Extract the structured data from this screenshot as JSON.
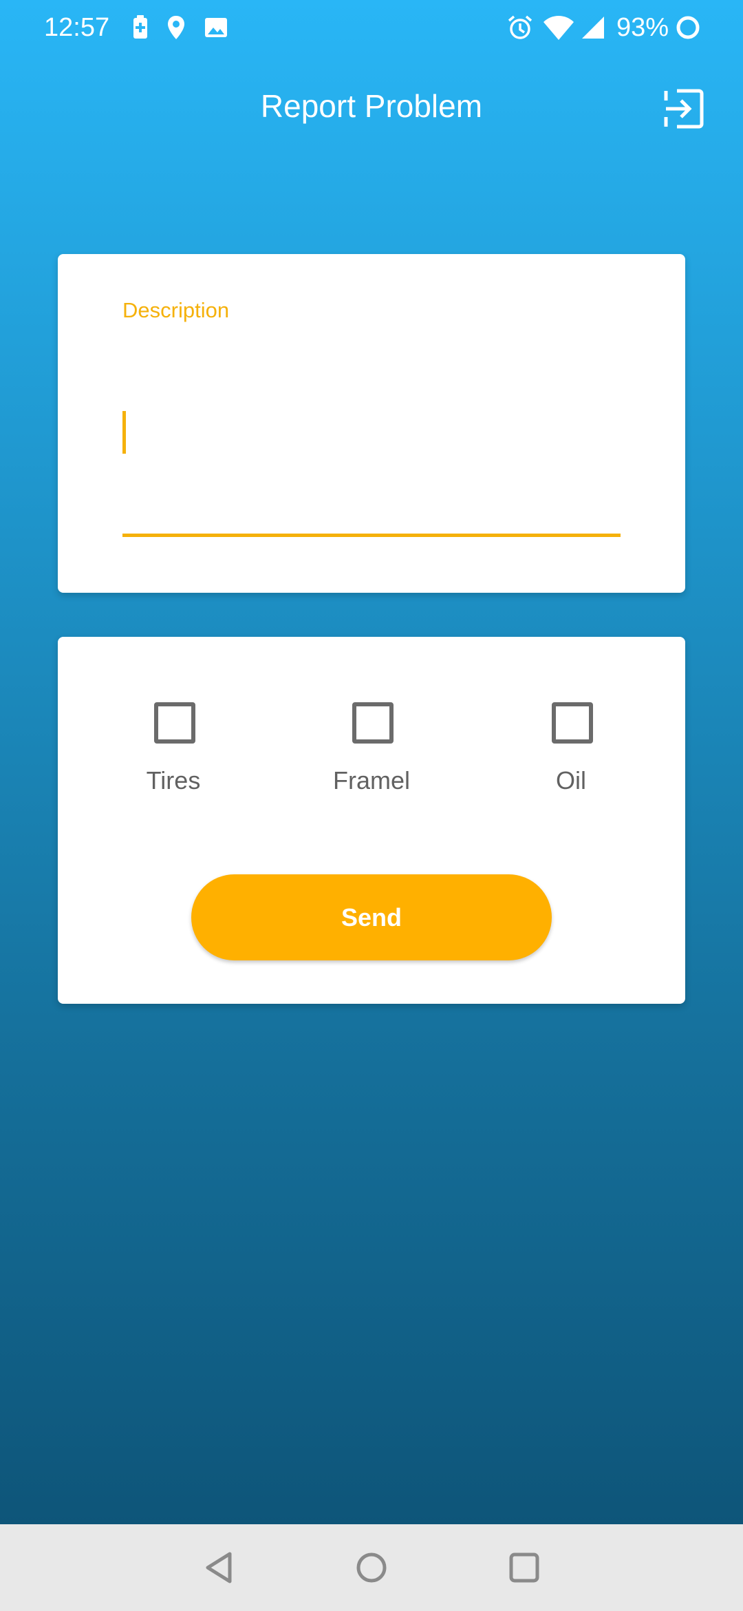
{
  "status_bar": {
    "time": "12:57",
    "battery_percent": "93%",
    "icons": [
      "battery-charging-icon",
      "location-icon",
      "image-icon",
      "alarm-icon",
      "wifi-icon",
      "signal-icon",
      "battery-ring-icon"
    ]
  },
  "app_bar": {
    "title": "Report Problem",
    "logout_icon": "logout-icon"
  },
  "description_field": {
    "label": "Description",
    "value": ""
  },
  "options": [
    {
      "label": "Tires",
      "checked": false
    },
    {
      "label": "Framel",
      "checked": false
    },
    {
      "label": "Oil",
      "checked": false
    }
  ],
  "send_button": {
    "label": "Send"
  },
  "nav_bar": {
    "icons": [
      "back-icon",
      "home-icon",
      "recents-icon"
    ]
  },
  "colors": {
    "accent": "#ffb000",
    "label_accent": "#f5b10b",
    "gradient_top": "#29b6f6",
    "gradient_bottom": "#0e5579"
  }
}
